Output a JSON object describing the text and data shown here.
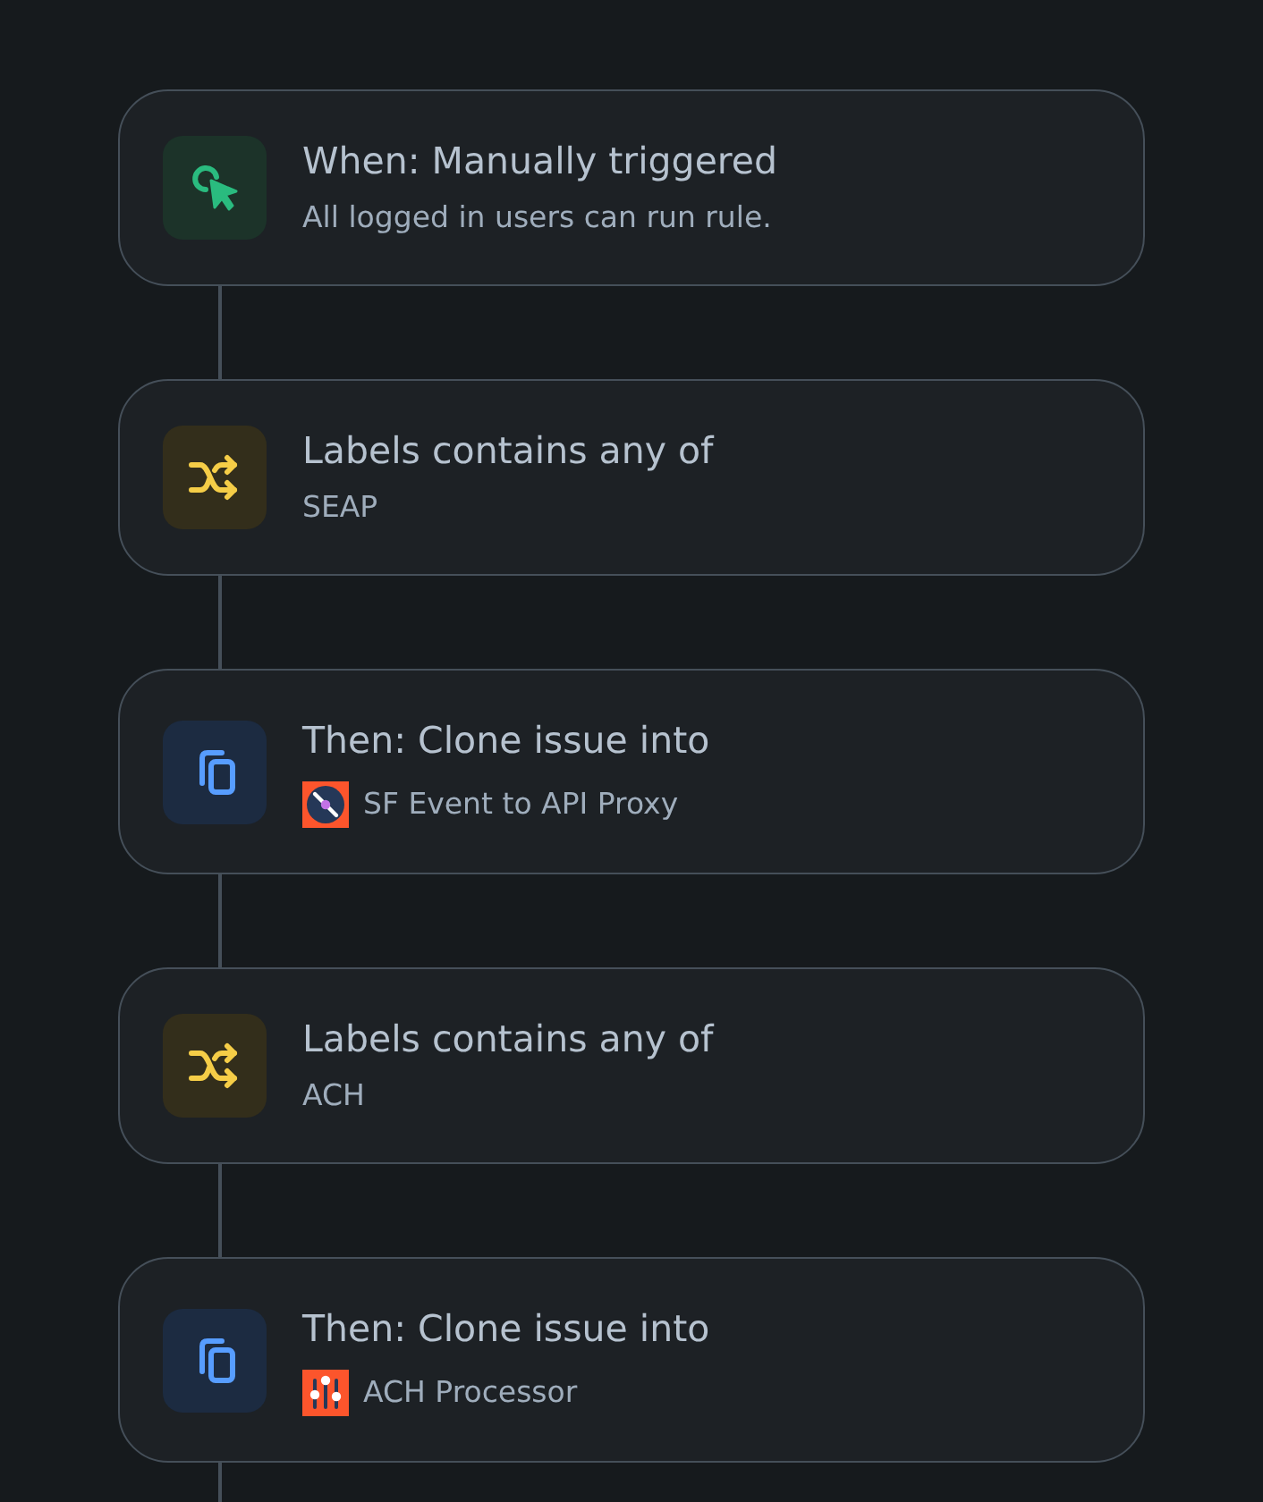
{
  "steps": [
    {
      "kind": "trigger",
      "title": "When: Manually triggered",
      "subtitle": "All logged in users can run rule."
    },
    {
      "kind": "condition",
      "title": "Labels contains any of",
      "subtitle": "SEAP"
    },
    {
      "kind": "action",
      "title": "Then: Clone issue into",
      "project": {
        "kind": "disc",
        "name": "SF Event to API Proxy"
      }
    },
    {
      "kind": "condition",
      "title": "Labels contains any of",
      "subtitle": "ACH"
    },
    {
      "kind": "action",
      "title": "Then: Clone issue into",
      "project": {
        "kind": "sliders",
        "name": "ACH Processor"
      }
    }
  ]
}
